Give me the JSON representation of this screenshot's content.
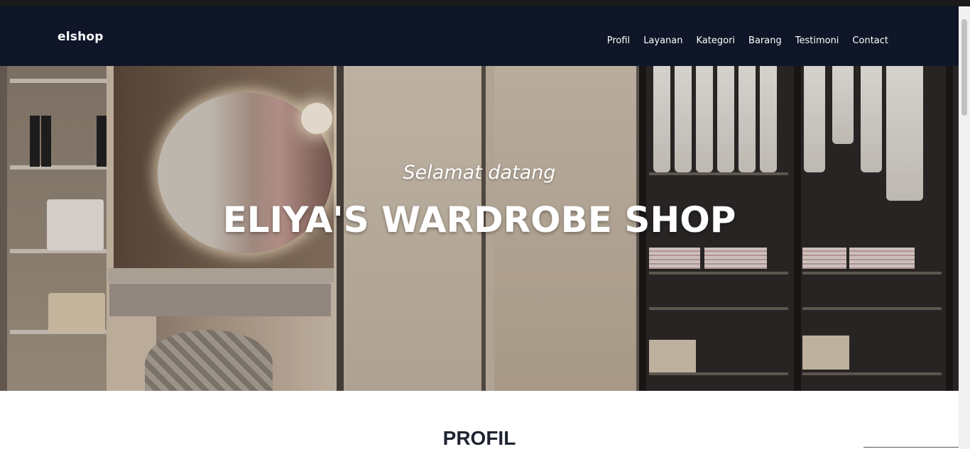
{
  "navbar": {
    "brand": "elshop",
    "links": [
      {
        "label": "Profil"
      },
      {
        "label": "Layanan"
      },
      {
        "label": "Kategori"
      },
      {
        "label": "Barang"
      },
      {
        "label": "Testimoni"
      },
      {
        "label": "Contact"
      }
    ]
  },
  "hero": {
    "subtitle": "Selamat datang",
    "title": "ELIYA'S WARDROBE SHOP"
  },
  "section": {
    "title": "PROFIL"
  },
  "colors": {
    "navbar_bg": "#0e1627",
    "text_light": "#ffffff",
    "section_title": "#1e2431"
  }
}
